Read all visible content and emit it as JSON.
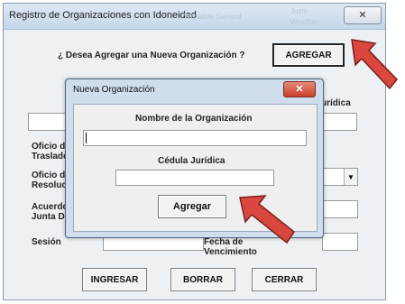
{
  "window": {
    "title": "Registro de Organizaciones con Idoneidad",
    "close_glyph": "✕",
    "ghost_tabs": [
      "Wiseable General",
      "Justo",
      "Westfiles"
    ]
  },
  "main": {
    "question": "¿ Desea Agregar una Nueva Organización ?",
    "agregar_button": "AGREGAR",
    "juridica_label": "urídica",
    "oficio_traslado_label": "Oficio de\nTraslado",
    "oficio_resolucion_label": "Oficio de\nResolució",
    "acuerdo_label": "Acuerdo\nJunta Di",
    "sesion_label": "Sesión",
    "vencimiento_label": "Fecha de\nVencimiento",
    "buttons": {
      "ingresar": "INGRESAR",
      "borrar": "BORRAR",
      "cerrar": "CERRAR"
    }
  },
  "modal": {
    "title": "Nueva Organización",
    "close_glyph": "✕",
    "nombre_label": "Nombre de la Organización",
    "nombre_value": "",
    "cedula_label": "Cédula Jurídica",
    "cedula_value": "",
    "agregar_button": "Agregar"
  },
  "colors": {
    "arrow": "#d9473f",
    "modal_border": "#4d6584",
    "modal_close": "#c8412c"
  },
  "icons": [
    "close-icon",
    "dropdown-arrow-icon",
    "pointer-arrow-icon"
  ]
}
